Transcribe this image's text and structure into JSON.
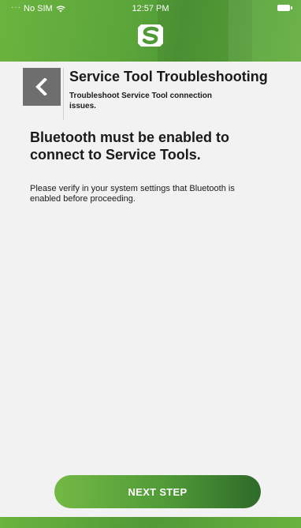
{
  "status_bar": {
    "carrier": "No SIM",
    "time": "12:57 PM",
    "icons": [
      "wifi-icon",
      "battery-icon"
    ]
  },
  "header": {
    "logo_icon": "brand-s-logo-icon"
  },
  "nav": {
    "back_icon": "chevron-left-icon",
    "title": "Service Tool Troubleshooting",
    "subtitle": "Troubleshoot Service Tool connection issues."
  },
  "content": {
    "heading": "Bluetooth must be enabled to connect to Service Tools.",
    "body": "Please verify in your system settings that Bluetooth is enabled before proceeding."
  },
  "actions": {
    "next_label": "NEXT STEP"
  },
  "colors": {
    "brand_green": "#5aa43a",
    "brand_dark_green": "#2f6a2a",
    "back_button_gray": "#6e6e6e",
    "background": "#f2f2f2"
  }
}
